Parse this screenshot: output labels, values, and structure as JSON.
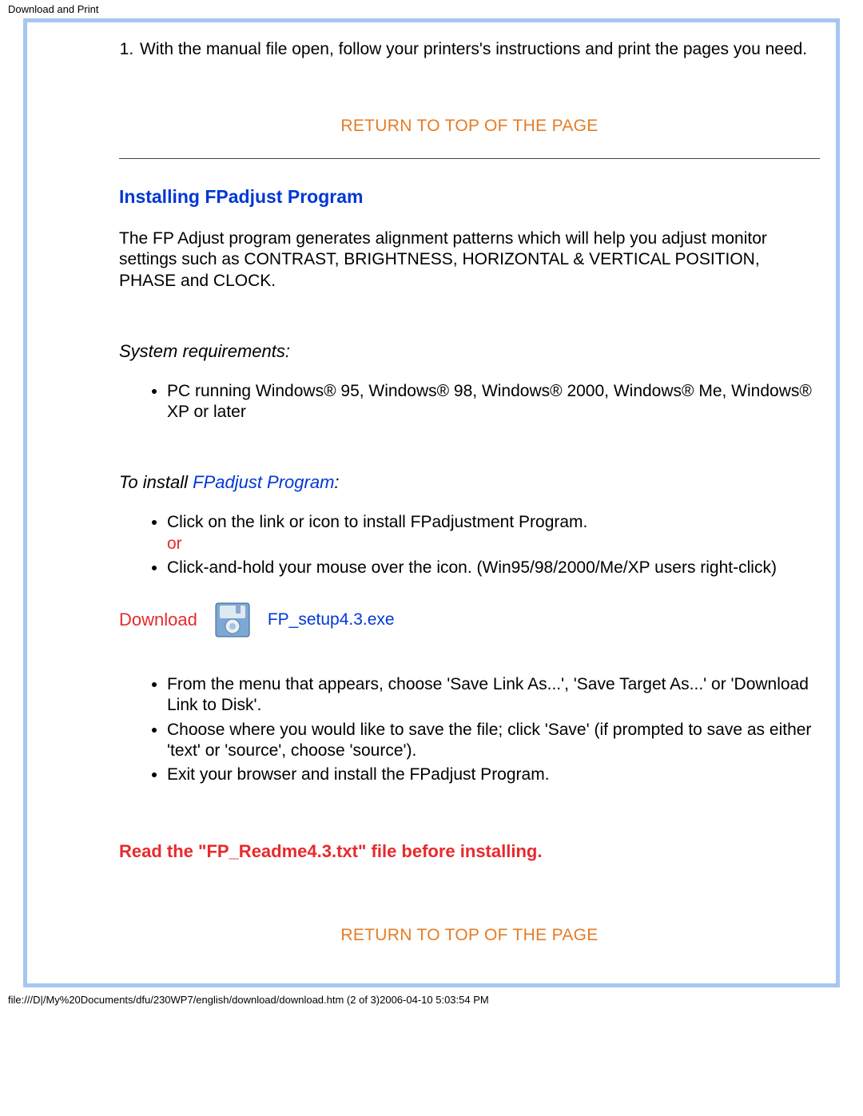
{
  "page": {
    "title_small": "Download and Print",
    "footer_path": "file:///D|/My%20Documents/dfu/230WP7/english/download/download.htm (2 of 3)2006-04-10 5:03:54 PM"
  },
  "top_list": {
    "items": [
      "With the manual file open, follow your printers's instructions and print the pages you need."
    ]
  },
  "return_link_label": "RETURN TO TOP OF THE PAGE",
  "fpadjust": {
    "heading": "Installing FPadjust Program",
    "intro": "The FP Adjust program generates alignment patterns which will help you adjust monitor settings such as CONTRAST, BRIGHTNESS, HORIZONTAL & VERTICAL POSITION, PHASE and CLOCK.",
    "sysreq_label": "System requirements:",
    "sysreq_items": [
      "PC running Windows® 95, Windows® 98, Windows® 2000, Windows® Me, Windows® XP or later"
    ],
    "install_label_prefix": "To install ",
    "install_label_link": "FPadjust Program",
    "install_label_suffix": ":",
    "install_items_first": "Click on the link or icon to install FPadjustment Program.",
    "or_label": "or",
    "install_items_second": "Click-and-hold your mouse over the icon. (Win95/98/2000/Me/XP users right-click)",
    "download_label": "Download",
    "download_filename": "FP_setup4.3.exe",
    "post_download_items": [
      "From the menu that appears, choose 'Save Link As...', 'Save Target As...' or 'Download Link to Disk'.",
      "Choose where you would like to save the file; click 'Save' (if prompted to save as either 'text' or 'source', choose 'source').",
      "Exit your browser and install the FPadjust Program."
    ],
    "readme_notice": "Read the \"FP_Readme4.3.txt\" file before installing."
  }
}
